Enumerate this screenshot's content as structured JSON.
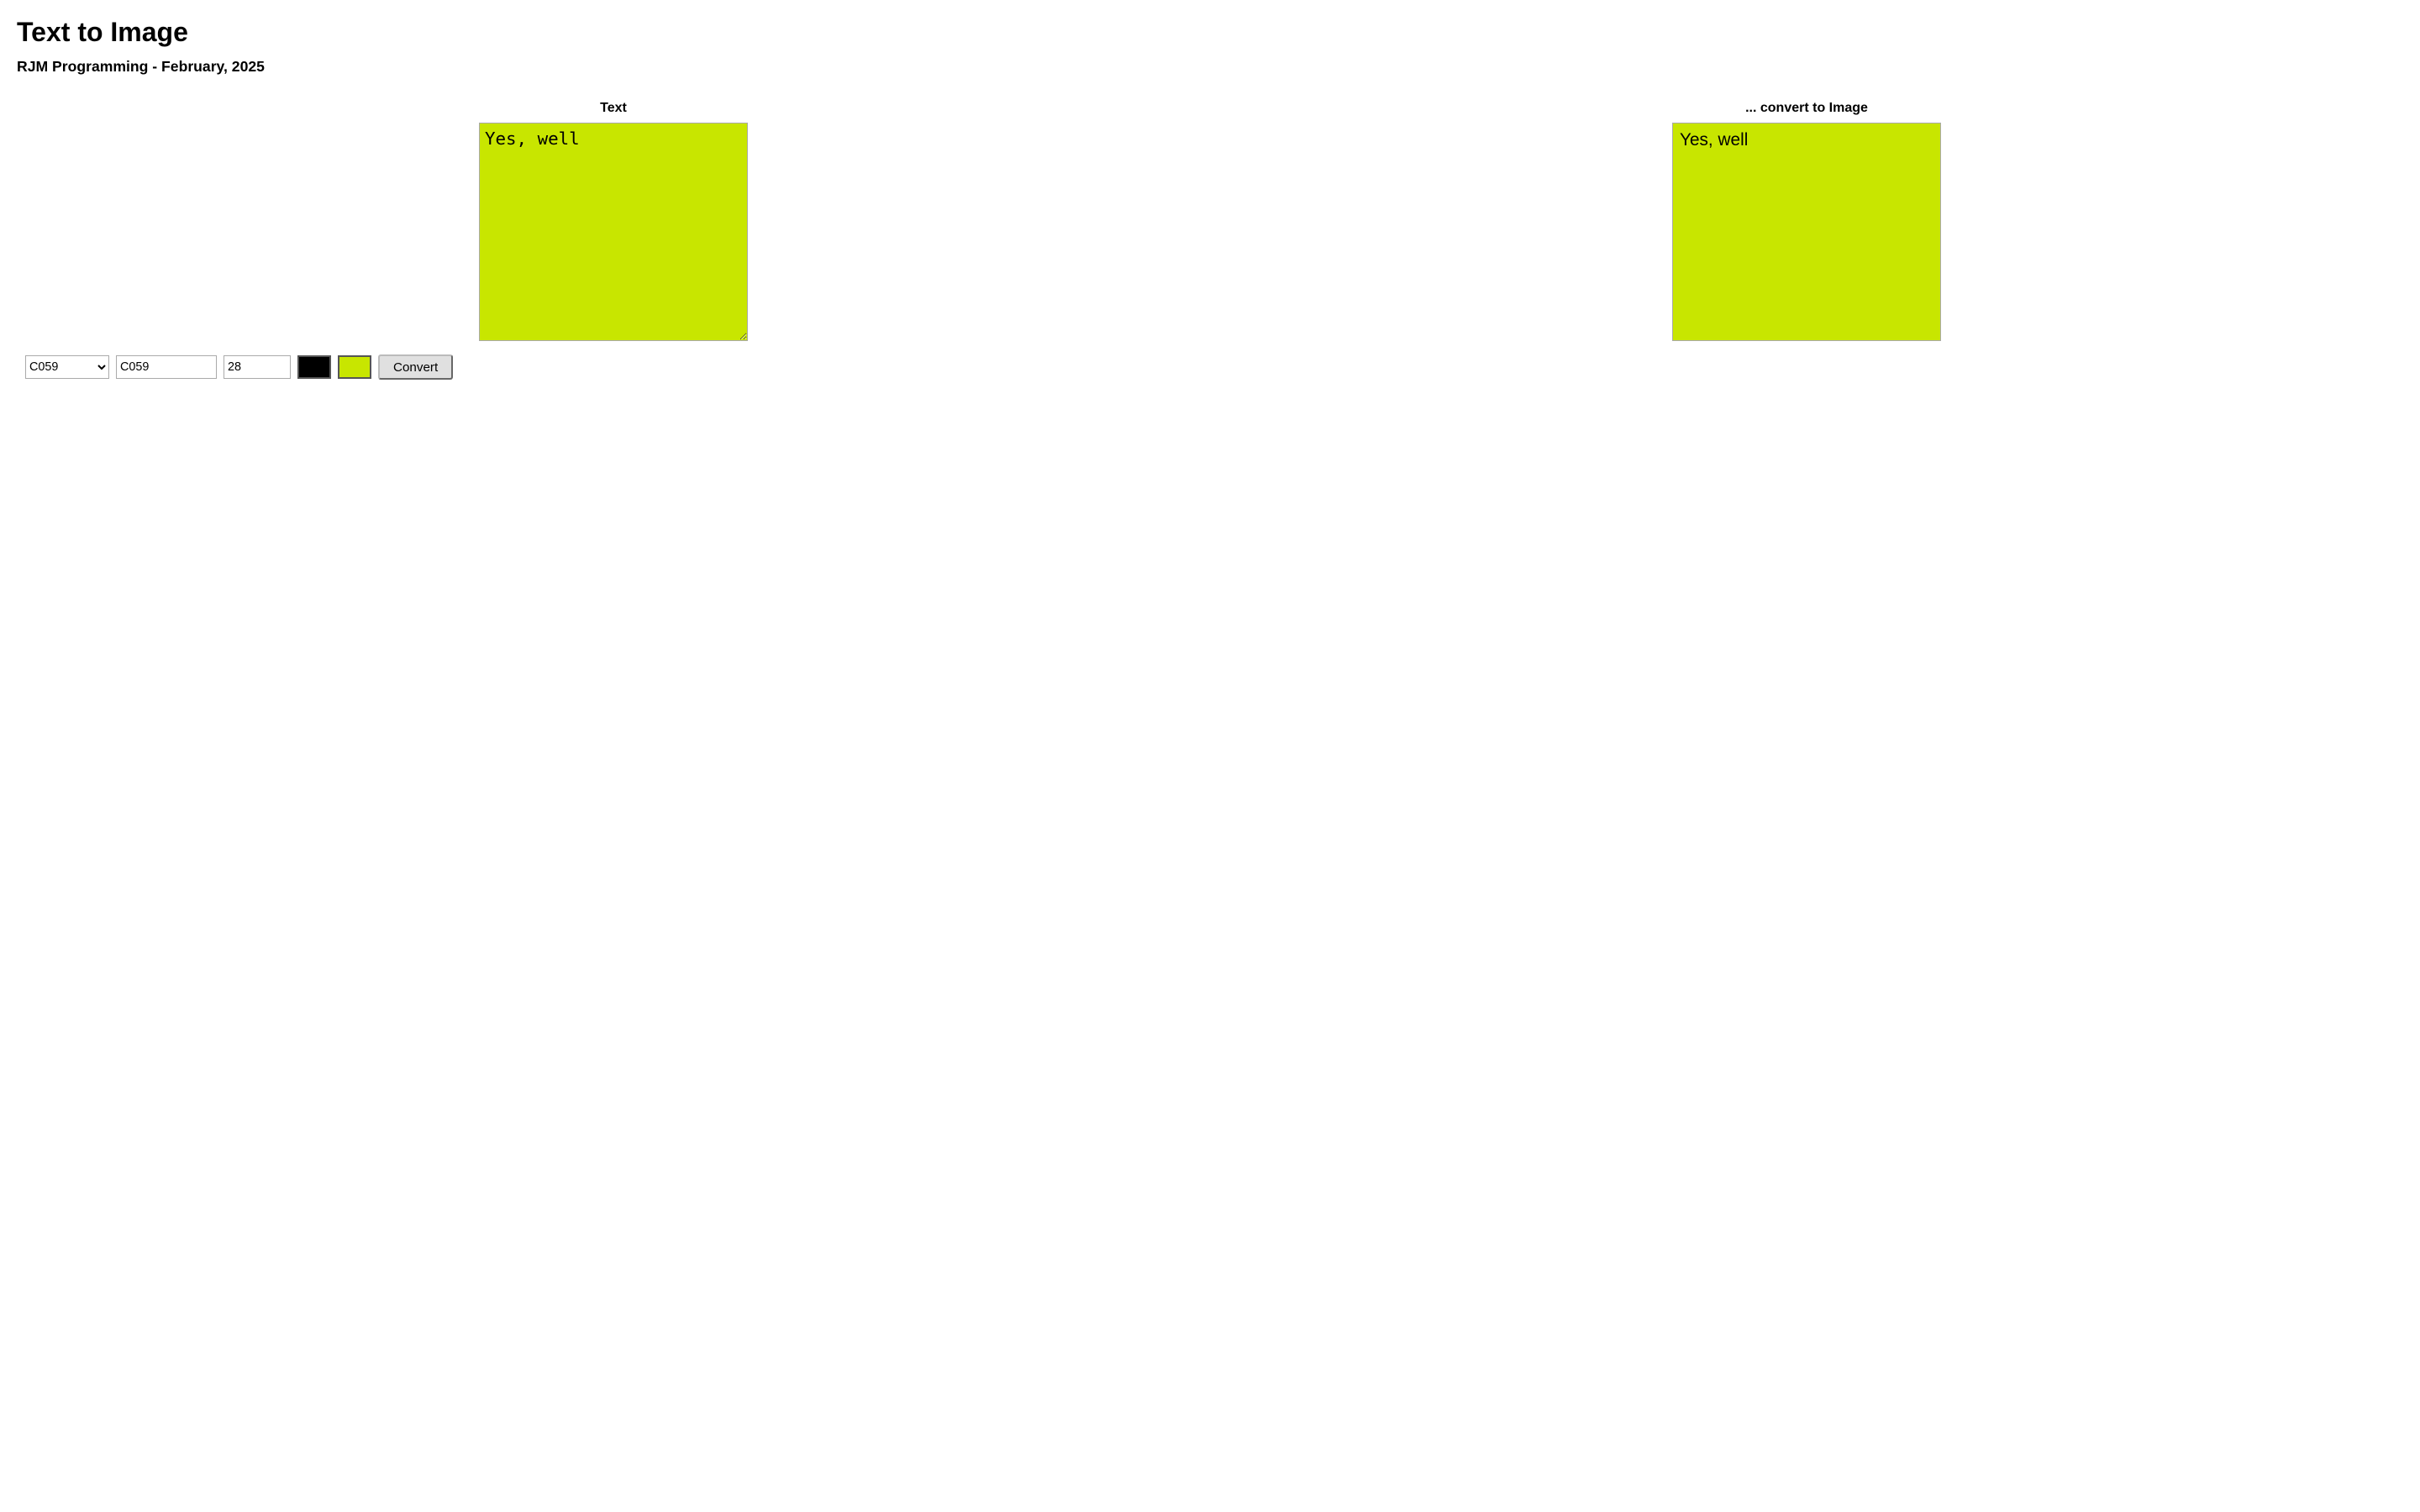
{
  "page": {
    "title": "Text to Image",
    "subtitle": "RJM Programming - February, 2025"
  },
  "text_column": {
    "label": "Text",
    "content": "Yes, well"
  },
  "image_column": {
    "label": "... convert to Image",
    "content": "Yes, well"
  },
  "controls": {
    "font_select_value": "C059",
    "font_input_value": "C059",
    "size_value": "28",
    "color_fg_label": "foreground color (black)",
    "color_bg_label": "background color (yellow-green)",
    "convert_label": "Convert"
  }
}
